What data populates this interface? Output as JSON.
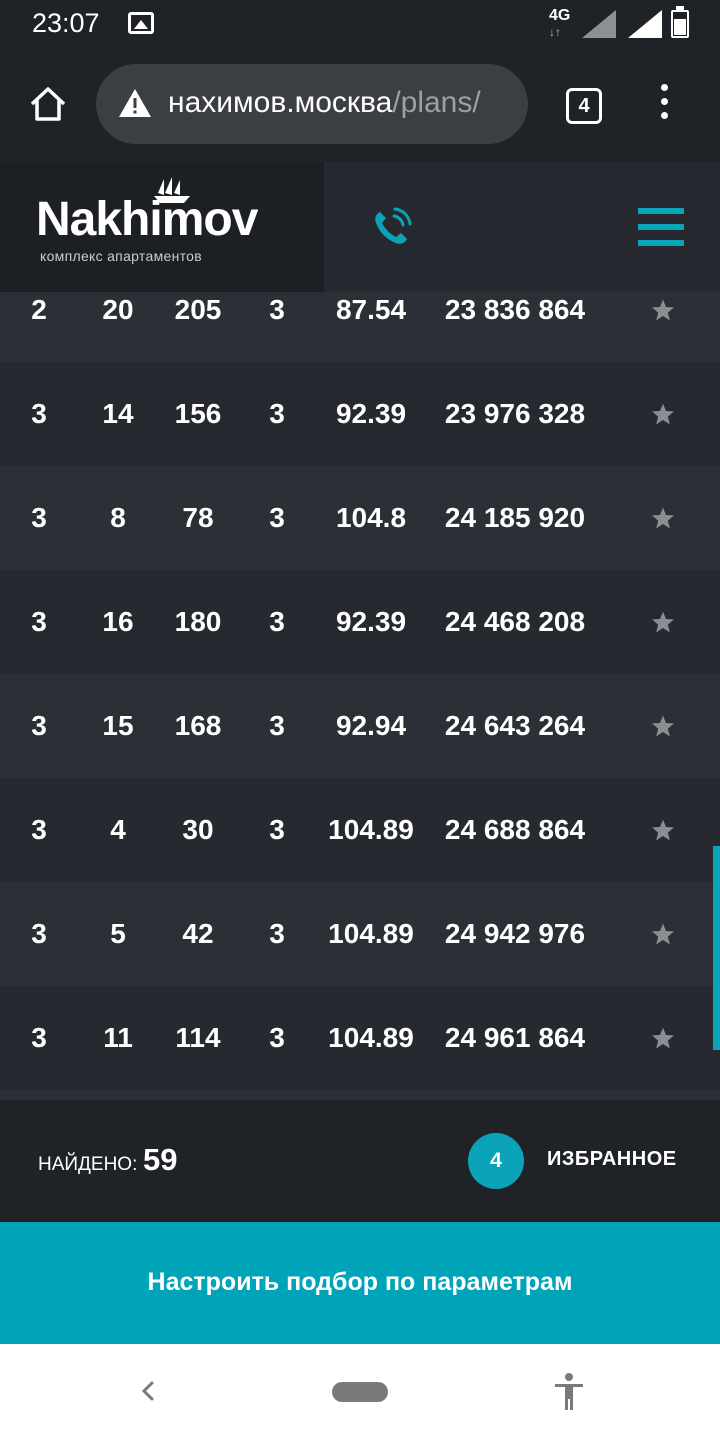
{
  "status_bar": {
    "time": "23:07",
    "network": "4G"
  },
  "browser": {
    "url_host": "нахимов.москва",
    "url_path": "/plans/",
    "tab_count": "4"
  },
  "site": {
    "logo_text": "Nakhimov",
    "logo_subtitle": "комплекс апартаментов",
    "accent_color": "#0aa3b8"
  },
  "table": {
    "rows": [
      [
        "2",
        "20",
        "205",
        "3",
        "87.54",
        "23 836 864"
      ],
      [
        "3",
        "14",
        "156",
        "3",
        "92.39",
        "23 976 328"
      ],
      [
        "3",
        "8",
        "78",
        "3",
        "104.8",
        "24 185 920"
      ],
      [
        "3",
        "16",
        "180",
        "3",
        "92.39",
        "24 468 208"
      ],
      [
        "3",
        "15",
        "168",
        "3",
        "92.94",
        "24 643 264"
      ],
      [
        "3",
        "4",
        "30",
        "3",
        "104.89",
        "24 688 864"
      ],
      [
        "3",
        "5",
        "42",
        "3",
        "104.89",
        "24 942 976"
      ],
      [
        "3",
        "11",
        "114",
        "3",
        "104.89",
        "24 961 864"
      ]
    ]
  },
  "footer": {
    "found_label": "НАЙДЕНО:",
    "found_count": "59",
    "favorites_count": "4",
    "favorites_label": "ИЗБРАННОЕ"
  },
  "filter_button_label": "Настроить подбор по параметрам",
  "icons": [
    "home-icon",
    "warning-icon",
    "tabs-icon",
    "more-icon",
    "phone-icon",
    "menu-icon",
    "star-icon",
    "back-icon",
    "accessibility-icon"
  ]
}
